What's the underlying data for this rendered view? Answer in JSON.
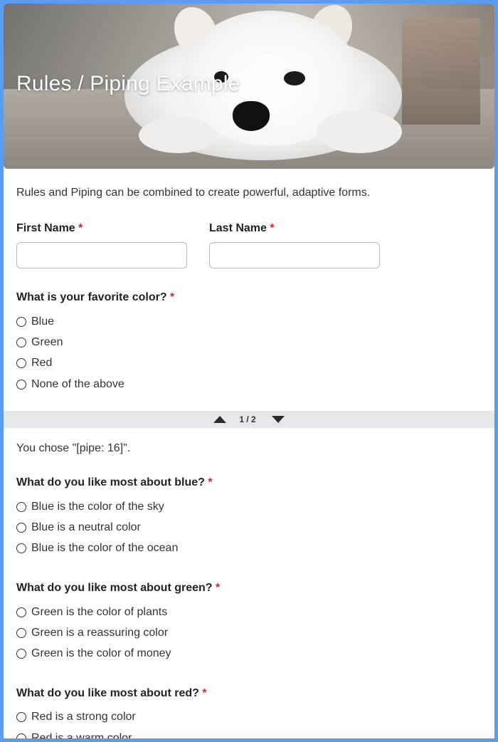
{
  "header": {
    "title": "Rules / Piping Example"
  },
  "intro": "Rules and Piping can be combined to create powerful, adaptive forms.",
  "required_mark": "*",
  "name_fields": [
    {
      "label": "First Name",
      "value": ""
    },
    {
      "label": "Last Name",
      "value": ""
    }
  ],
  "color_question": {
    "label": "What is your favorite color?",
    "options": [
      "Blue",
      "Green",
      "Red",
      "None of the above"
    ]
  },
  "pager": {
    "text": "1 / 2"
  },
  "piped_text": "You chose \"[pipe: 16]\".",
  "blue_question": {
    "label": "What do you like most about blue?",
    "options": [
      "Blue is the color of the sky",
      "Blue is a neutral color",
      "Blue is the color of the ocean"
    ]
  },
  "green_question": {
    "label": "What do you like most about green?",
    "options": [
      "Green is the color of plants",
      "Green is a reassuring color",
      "Green is the color of money"
    ]
  },
  "red_question": {
    "label": "What do you like most about red?",
    "options": [
      "Red is a strong color",
      "Red is a warm color"
    ]
  },
  "colors": {
    "frame": "#5b9cf0",
    "required": "#d8232a",
    "pager_bg": "#e5e7ea"
  }
}
